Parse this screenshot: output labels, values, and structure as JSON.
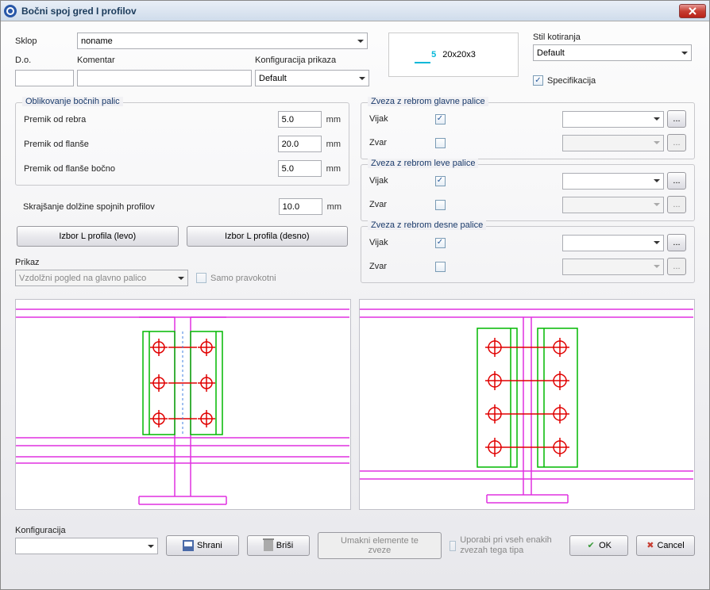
{
  "title": "Bočni spoj gred I profilov",
  "labels": {
    "sklop": "Sklop",
    "do": "D.o.",
    "komentar": "Komentar",
    "konfiguracija_prikaza": "Konfiguracija prikaza",
    "stil_kotiranja": "Stil kotiranja",
    "specifikacija": "Specifikacija"
  },
  "values": {
    "sklop": "noname",
    "do": "",
    "komentar": "",
    "konfiguracija_prikaza": "Default",
    "stil_kotiranja": "Default",
    "specifikacija_checked": true,
    "info_num": "5",
    "info_size": "20x20x3"
  },
  "group_oblikovanje": {
    "legend": "Oblikovanje bočnih palic",
    "premik_od_rebra": {
      "label": "Premik od rebra",
      "value": "5.0",
      "unit": "mm"
    },
    "premik_od_flanse": {
      "label": "Premik od flanše",
      "value": "20.0",
      "unit": "mm"
    },
    "premik_od_flanse_bocno": {
      "label": "Premik od flanše bočno",
      "value": "5.0",
      "unit": "mm"
    }
  },
  "skrajsanje": {
    "label": "Skrajšanje dolžine spojnih profilov",
    "value": "10.0",
    "unit": "mm"
  },
  "buttons": {
    "izbor_levo": "Izbor L profila (levo)",
    "izbor_desno": "Izbor L profila (desno)"
  },
  "prikaz": {
    "label": "Prikaz",
    "value": "Vzdolžni pogled na glavno palico",
    "samo_pravokotni": "Samo pravokotni",
    "samo_pravokotni_checked": false
  },
  "conn_glavne": {
    "legend": "Zveza z rebrom glavne palice",
    "vijak": "Vijak",
    "vijak_checked": true,
    "zvar": "Zvar",
    "zvar_checked": false
  },
  "conn_leve": {
    "legend": "Zveza z rebrom leve palice",
    "vijak": "Vijak",
    "vijak_checked": true,
    "zvar": "Zvar",
    "zvar_checked": false
  },
  "conn_desne": {
    "legend": "Zveza z rebrom desne palice",
    "vijak": "Vijak",
    "vijak_checked": true,
    "zvar": "Zvar",
    "zvar_checked": false
  },
  "footer": {
    "konfiguracija": "Konfiguracija",
    "shrani": "Shrani",
    "brisi": "Briši",
    "umakni": "Umakni elemente te zveze",
    "uporabi": "Uporabi pri vseh enakih zvezah tega tipa",
    "uporabi_checked": false,
    "ok": "OK",
    "cancel": "Cancel"
  },
  "ellipsis": "..."
}
